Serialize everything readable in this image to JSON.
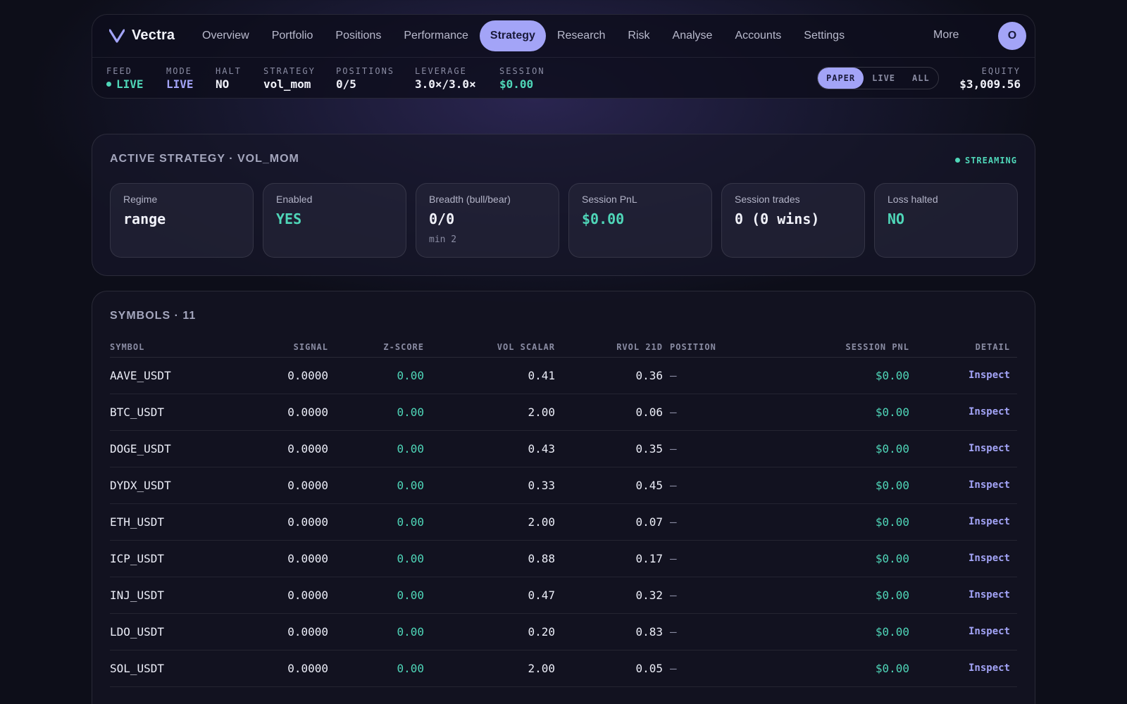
{
  "brand": {
    "name": "Vectra"
  },
  "nav": {
    "links": [
      "Overview",
      "Portfolio",
      "Positions",
      "Performance",
      "Strategy",
      "Research",
      "Risk",
      "Analyse",
      "Accounts",
      "Settings"
    ],
    "active": "Strategy",
    "more": "More",
    "avatar_initial": "O"
  },
  "status": {
    "feed": {
      "label": "FEED",
      "value": "LIVE"
    },
    "mode": {
      "label": "MODE",
      "value": "LIVE"
    },
    "halt": {
      "label": "HALT",
      "value": "NO"
    },
    "strategy": {
      "label": "STRATEGY",
      "value": "vol_mom"
    },
    "positions": {
      "label": "POSITIONS",
      "value": "0/5"
    },
    "leverage": {
      "label": "LEVERAGE",
      "value": "3.0×/3.0×"
    },
    "session": {
      "label": "SESSION",
      "value": "$0.00"
    },
    "equity": {
      "label": "EQUITY",
      "value": "$3,009.56"
    }
  },
  "account_filter": {
    "options": [
      "PAPER",
      "LIVE",
      "ALL"
    ],
    "selected": "PAPER"
  },
  "strategy_card": {
    "title": "ACTIVE STRATEGY · VOL_MOM",
    "streaming_label": "STREAMING",
    "kpis": [
      {
        "label": "Regime",
        "value": "range",
        "sub": ""
      },
      {
        "label": "Enabled",
        "value": "YES",
        "sub": ""
      },
      {
        "label": "Breadth (bull/bear)",
        "value": "0/0",
        "sub": "min 2"
      },
      {
        "label": "Session PnL",
        "value": "$0.00",
        "sub": ""
      },
      {
        "label": "Session trades",
        "value": "0 (0 wins)",
        "sub": ""
      },
      {
        "label": "Loss halted",
        "value": "NO",
        "sub": ""
      }
    ]
  },
  "symbols": {
    "title": "SYMBOLS · 11",
    "columns": [
      "SYMBOL",
      "SIGNAL",
      "Z-SCORE",
      "VOL SCALAR",
      "RVOL 21D",
      "POSITION",
      "SESSION PNL",
      "DETAIL"
    ],
    "rows": [
      {
        "symbol": "AAVE_USDT",
        "signal": "0.0000",
        "z": "0.00",
        "vol": "0.41",
        "rvol": "0.36",
        "position": "—",
        "pnl": "$0.00",
        "detail": "Inspect"
      },
      {
        "symbol": "BTC_USDT",
        "signal": "0.0000",
        "z": "0.00",
        "vol": "2.00",
        "rvol": "0.06",
        "position": "—",
        "pnl": "$0.00",
        "detail": "Inspect"
      },
      {
        "symbol": "DOGE_USDT",
        "signal": "0.0000",
        "z": "0.00",
        "vol": "0.43",
        "rvol": "0.35",
        "position": "—",
        "pnl": "$0.00",
        "detail": "Inspect"
      },
      {
        "symbol": "DYDX_USDT",
        "signal": "0.0000",
        "z": "0.00",
        "vol": "0.33",
        "rvol": "0.45",
        "position": "—",
        "pnl": "$0.00",
        "detail": "Inspect"
      },
      {
        "symbol": "ETH_USDT",
        "signal": "0.0000",
        "z": "0.00",
        "vol": "2.00",
        "rvol": "0.07",
        "position": "—",
        "pnl": "$0.00",
        "detail": "Inspect"
      },
      {
        "symbol": "ICP_USDT",
        "signal": "0.0000",
        "z": "0.00",
        "vol": "0.88",
        "rvol": "0.17",
        "position": "—",
        "pnl": "$0.00",
        "detail": "Inspect"
      },
      {
        "symbol": "INJ_USDT",
        "signal": "0.0000",
        "z": "0.00",
        "vol": "0.47",
        "rvol": "0.32",
        "position": "—",
        "pnl": "$0.00",
        "detail": "Inspect"
      },
      {
        "symbol": "LDO_USDT",
        "signal": "0.0000",
        "z": "0.00",
        "vol": "0.20",
        "rvol": "0.83",
        "position": "—",
        "pnl": "$0.00",
        "detail": "Inspect"
      },
      {
        "symbol": "SOL_USDT",
        "signal": "0.0000",
        "z": "0.00",
        "vol": "2.00",
        "rvol": "0.05",
        "position": "—",
        "pnl": "$0.00",
        "detail": "Inspect"
      }
    ]
  },
  "colors": {
    "accent": "#a3a4f7",
    "positive": "#4fd6b8",
    "background": "#0d0e19"
  },
  "icons": {
    "logo": "v-chevron-logo-icon",
    "live": "live-dot-icon",
    "streaming": "streaming-dot-icon"
  }
}
